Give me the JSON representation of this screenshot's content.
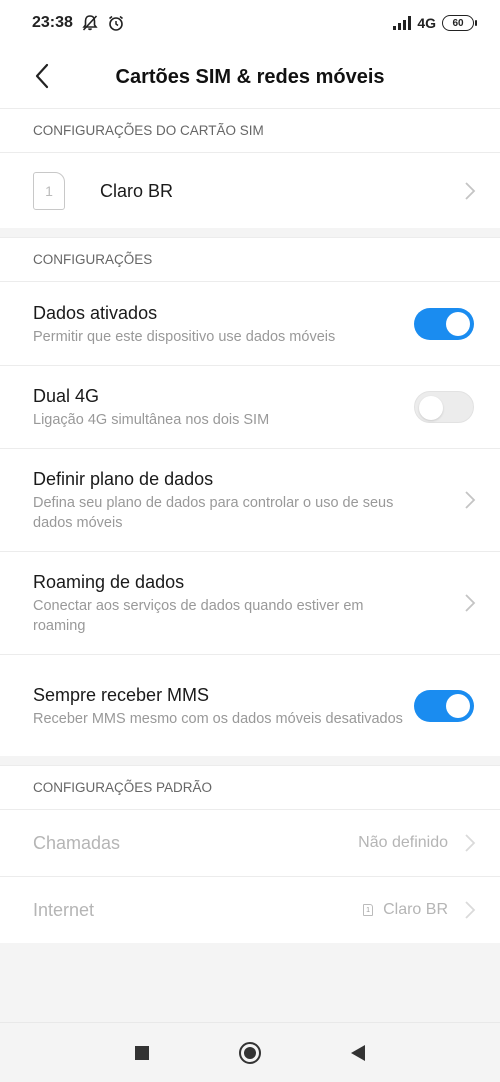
{
  "status_bar": {
    "time": "23:38",
    "network": "4G",
    "battery": "60"
  },
  "header": {
    "title": "Cartões SIM & redes móveis"
  },
  "sim_section": {
    "header": "CONFIGURAÇÕES DO CARTÃO SIM",
    "sim_slot": "1",
    "sim_name": "Claro BR"
  },
  "config_section": {
    "header": "CONFIGURAÇÕES",
    "items": [
      {
        "title": "Dados ativados",
        "subtitle": "Permitir que este dispositivo use dados móveis",
        "toggle": true
      },
      {
        "title": "Dual 4G",
        "subtitle": "Ligação 4G simultânea nos dois SIM",
        "toggle": false
      },
      {
        "title": "Definir plano de dados",
        "subtitle": "Defina seu plano de dados para controlar o uso de seus dados móveis"
      },
      {
        "title": "Roaming de dados",
        "subtitle": "Conectar aos serviços de dados quando estiver em roaming"
      },
      {
        "title": "Sempre receber MMS",
        "subtitle": "Receber MMS mesmo com os dados móveis desativados",
        "toggle": true
      }
    ]
  },
  "default_section": {
    "header": "CONFIGURAÇÕES PADRÃO",
    "items": [
      {
        "title": "Chamadas",
        "value": "Não definido"
      },
      {
        "title": "Internet",
        "value": "Claro BR",
        "sim_slot": "1"
      }
    ]
  },
  "colors": {
    "accent": "#1a8cf0",
    "background": "#f4f4f4"
  }
}
